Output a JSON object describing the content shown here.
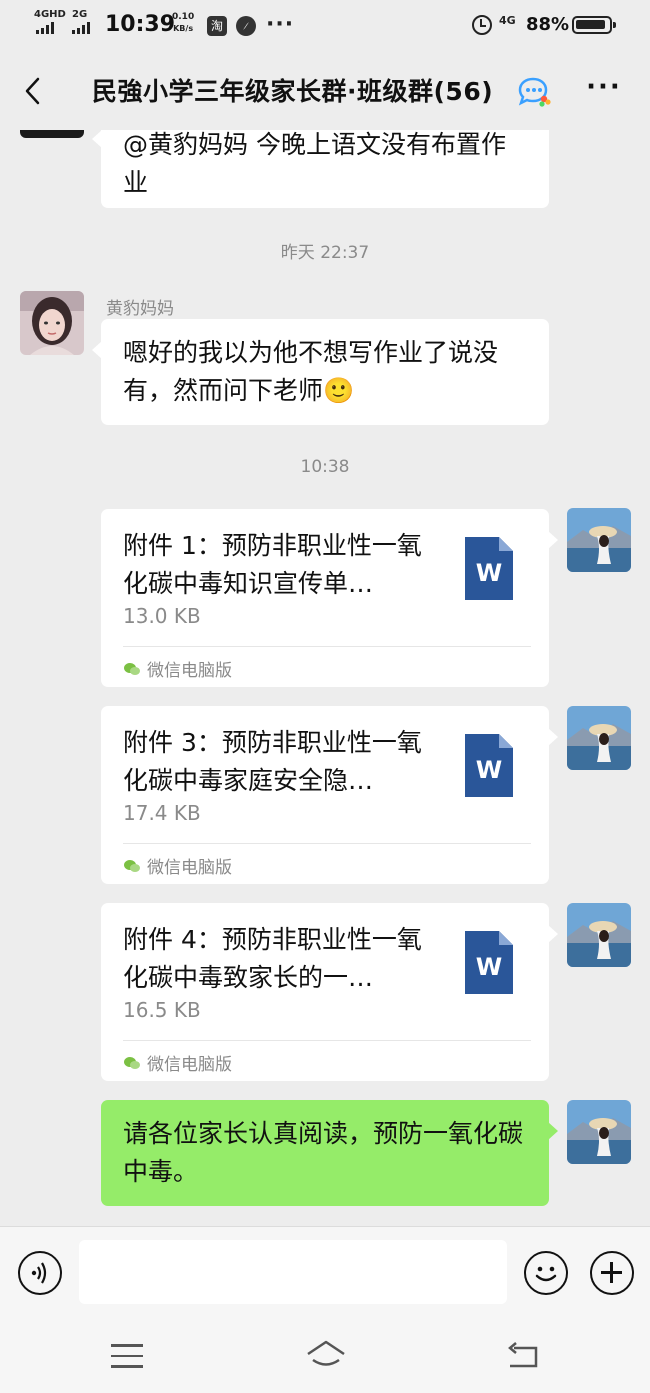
{
  "status_bar": {
    "network_1": "4GHD",
    "network_2": "2G",
    "time": "10:39",
    "speed_value": "0.10",
    "speed_unit": "KB/s",
    "taobao_glyph": "淘",
    "network_3": "4G",
    "battery_percent": "88%",
    "battery_level": 0.88,
    "icons": [
      "signal-icon",
      "taobao-icon",
      "compass-icon",
      "more-dots-icon",
      "alarm-icon",
      "battery-icon"
    ]
  },
  "header": {
    "title": "民強小学三年级家长群·班级群(56)",
    "more_label": "···"
  },
  "messages": {
    "partial_message": "@黄豹妈妈 今晚上语文没有布置作业",
    "time_1": "昨天 22:37",
    "sender_name": "黄豹妈妈",
    "reply_text": "嗯好的我以为他不想写作业了说没有，然而问下老师",
    "reply_emoji": "🙂",
    "time_2": "10:38",
    "files": [
      {
        "name": "附件 1：预防非职业性一氧化碳中毒知识宣传单…",
        "size": "13.0 KB",
        "source": "微信电脑版",
        "icon_letter": "W"
      },
      {
        "name": "附件 3：预防非职业性一氧化碳中毒家庭安全隐…",
        "size": "17.4 KB",
        "source": "微信电脑版",
        "icon_letter": "W"
      },
      {
        "name": "附件 4：预防非职业性一氧化碳中毒致家长的一…",
        "size": "16.5 KB",
        "source": "微信电脑版",
        "icon_letter": "W"
      }
    ],
    "final_text": "请各位家长认真阅读，预防一氧化碳中毒。"
  },
  "input": {
    "placeholder": "",
    "value": ""
  },
  "colors": {
    "background": "#ededed",
    "bubble_white": "#ffffff",
    "bubble_green": "#95ec69",
    "word_blue": "#2a5699",
    "timestamp_gray": "#8a8a8a"
  }
}
